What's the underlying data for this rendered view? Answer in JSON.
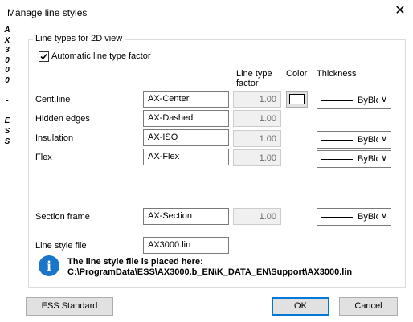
{
  "window": {
    "title": "Manage line styles"
  },
  "side_strip": [
    "A",
    "X",
    "3",
    "0",
    "0",
    "0",
    "",
    "-",
    "",
    "E",
    "S",
    "S"
  ],
  "group": {
    "legend": "Line types for 2D view",
    "auto_factor_label": "Automatic line type factor",
    "auto_factor_checked": true
  },
  "headers": {
    "line_type_factor": "Line type factor",
    "color": "Color",
    "thickness": "Thickness"
  },
  "rows": [
    {
      "label": "Cent.line",
      "line_type": "AX-Center",
      "factor": "1.00",
      "thickness": "ByBlock"
    },
    {
      "label": "Hidden edges",
      "line_type": "AX-Dashed",
      "factor": "1.00"
    },
    {
      "label": "Insulation",
      "line_type": "AX-ISO",
      "factor": "1.00",
      "thickness": "ByBlock"
    },
    {
      "label": "Flex",
      "line_type": "AX-Flex",
      "factor": "1.00",
      "thickness": "ByBlock"
    },
    {
      "label": "Section frame",
      "line_type": "AX-Section",
      "factor": "1.00",
      "thickness": "ByBlock"
    }
  ],
  "line_style_file": {
    "label": "Line style file",
    "value": "AX3000.lin"
  },
  "info": {
    "line1": "The line style file is placed here:",
    "line2": "C:\\ProgramData\\ESS\\AX3000.b_EN\\K_DATA_EN\\Support\\AX3000.lin"
  },
  "buttons": {
    "ess_standard": "ESS Standard",
    "ok": "OK",
    "cancel": "Cancel"
  }
}
